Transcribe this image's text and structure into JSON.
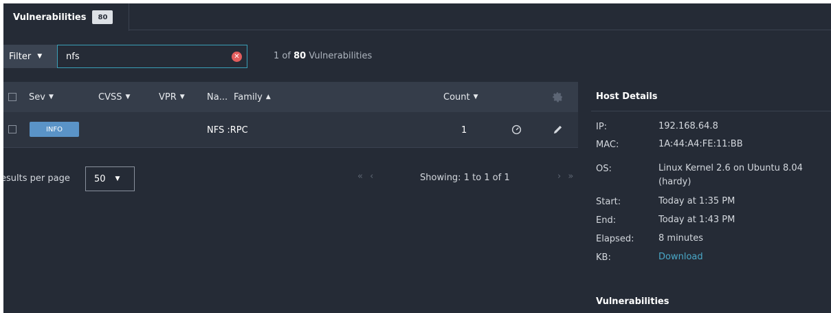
{
  "tab": {
    "label": "Vulnerabilities",
    "badge": "80"
  },
  "filter": {
    "button_label": "Filter",
    "search_value": "nfs",
    "result_prefix": "1 of",
    "result_total": "80",
    "result_suffix": "Vulnerabilities"
  },
  "table": {
    "columns": {
      "sev": "Sev",
      "cvss": "CVSS",
      "vpr": "VPR",
      "name": "Na...",
      "family": "Family",
      "count": "Count"
    },
    "rows": [
      {
        "sev": "INFO",
        "cvss": "",
        "vpr": "",
        "family": "NFS :RPC",
        "count": "1"
      }
    ]
  },
  "pagination": {
    "rpp_label": "esults per page",
    "rpp_value": "50",
    "prev": "« ‹",
    "showing": "Showing: 1 to 1 of 1",
    "next": "› »"
  },
  "host": {
    "title": "Host Details",
    "ip_label": "IP:",
    "ip": "192.168.64.8",
    "mac_label": "MAC:",
    "mac": "1A:44:A4:FE:11:BB",
    "os_label": "OS:",
    "os": "Linux Kernel 2.6 on Ubuntu 8.04 (hardy)",
    "start_label": "Start:",
    "start": "Today at 1:35 PM",
    "end_label": "End:",
    "end": "Today at 1:43 PM",
    "elapsed_label": "Elapsed:",
    "elapsed": "8 minutes",
    "kb_label": "KB:",
    "kb": "Download"
  },
  "vulns_title": "Vulnerabilities",
  "colors": {
    "background": "#252b36",
    "accent_link": "#4aa8c8",
    "info_badge": "#5a93c7",
    "search_border": "#3aa0b8",
    "clear_icon": "#e35d5d"
  }
}
